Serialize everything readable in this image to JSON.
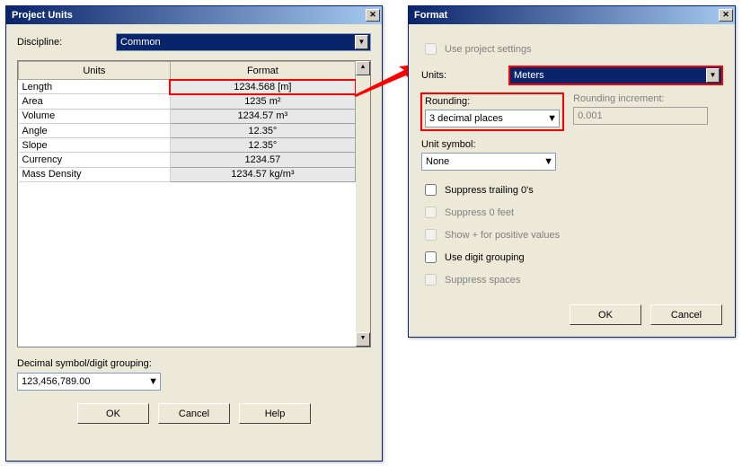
{
  "project_units": {
    "title": "Project Units",
    "discipline_label": "Discipline:",
    "discipline_value": "Common",
    "headers": {
      "units": "Units",
      "format": "Format"
    },
    "rows": [
      {
        "unit": "Length",
        "format": "1234.568 [m]",
        "highlight": true
      },
      {
        "unit": "Area",
        "format": "1235 m²"
      },
      {
        "unit": "Volume",
        "format": "1234.57 m³"
      },
      {
        "unit": "Angle",
        "format": "12.35°"
      },
      {
        "unit": "Slope",
        "format": "12.35°"
      },
      {
        "unit": "Currency",
        "format": "1234.57"
      },
      {
        "unit": "Mass Density",
        "format": "1234.57 kg/m³"
      }
    ],
    "decimal_label": "Decimal symbol/digit grouping:",
    "decimal_value": "123,456,789.00",
    "ok": "OK",
    "cancel": "Cancel",
    "help": "Help"
  },
  "format": {
    "title": "Format",
    "use_project_settings": "Use project settings",
    "units_label": "Units:",
    "units_value": "Meters",
    "rounding_label": "Rounding:",
    "rounding_value": "3 decimal places",
    "rounding_increment_label": "Rounding increment:",
    "rounding_increment_value": "0.001",
    "unit_symbol_label": "Unit symbol:",
    "unit_symbol_value": "None",
    "suppress_trailing": "Suppress trailing 0's",
    "suppress_0_feet": "Suppress 0 feet",
    "show_plus": "Show + for positive values",
    "digit_grouping": "Use digit grouping",
    "suppress_spaces": "Suppress spaces",
    "ok": "OK",
    "cancel": "Cancel"
  }
}
